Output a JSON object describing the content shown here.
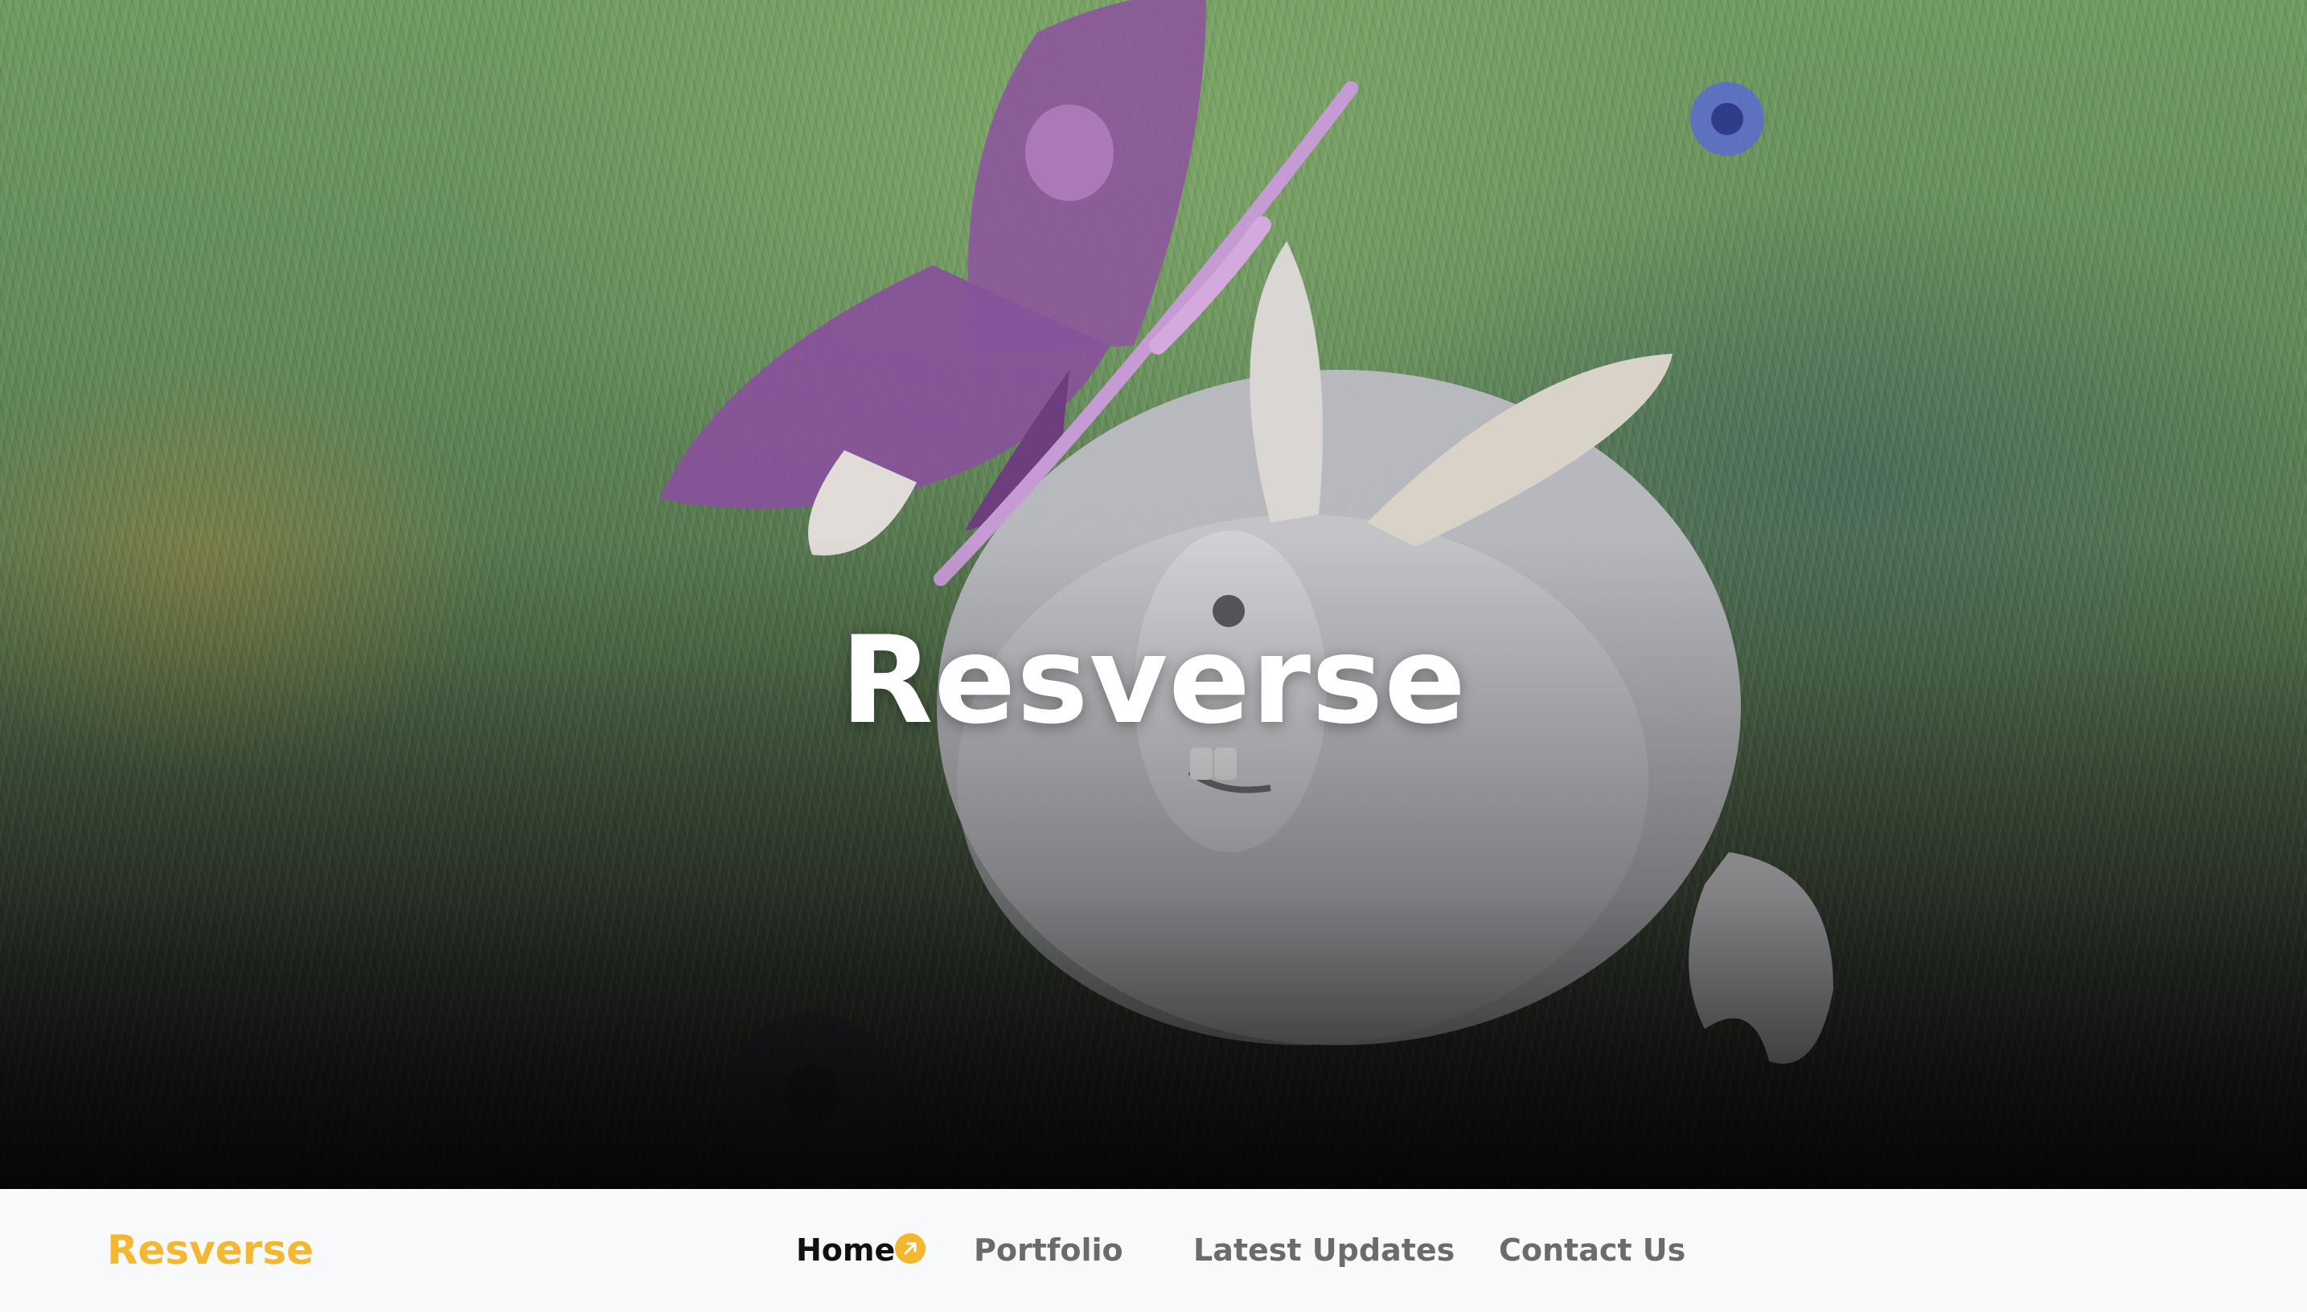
{
  "hero": {
    "title": "Resverse",
    "background": "hero-image-bunny-butterfly"
  },
  "navbar": {
    "brand": "Resverse",
    "items": [
      {
        "label": "Home",
        "active": true
      },
      {
        "label": "Portfolio",
        "active": false
      },
      {
        "label": "Latest Updates",
        "active": false
      },
      {
        "label": "Contact Us",
        "active": false
      }
    ],
    "active_indicator_icon": "arrow-up-right-icon"
  },
  "colors": {
    "brand": "#f4b732",
    "nav_text": "#6b6b6b",
    "nav_active": "#111111",
    "navbar_bg": "#f8f9fb",
    "hero_title": "#ffffff"
  }
}
